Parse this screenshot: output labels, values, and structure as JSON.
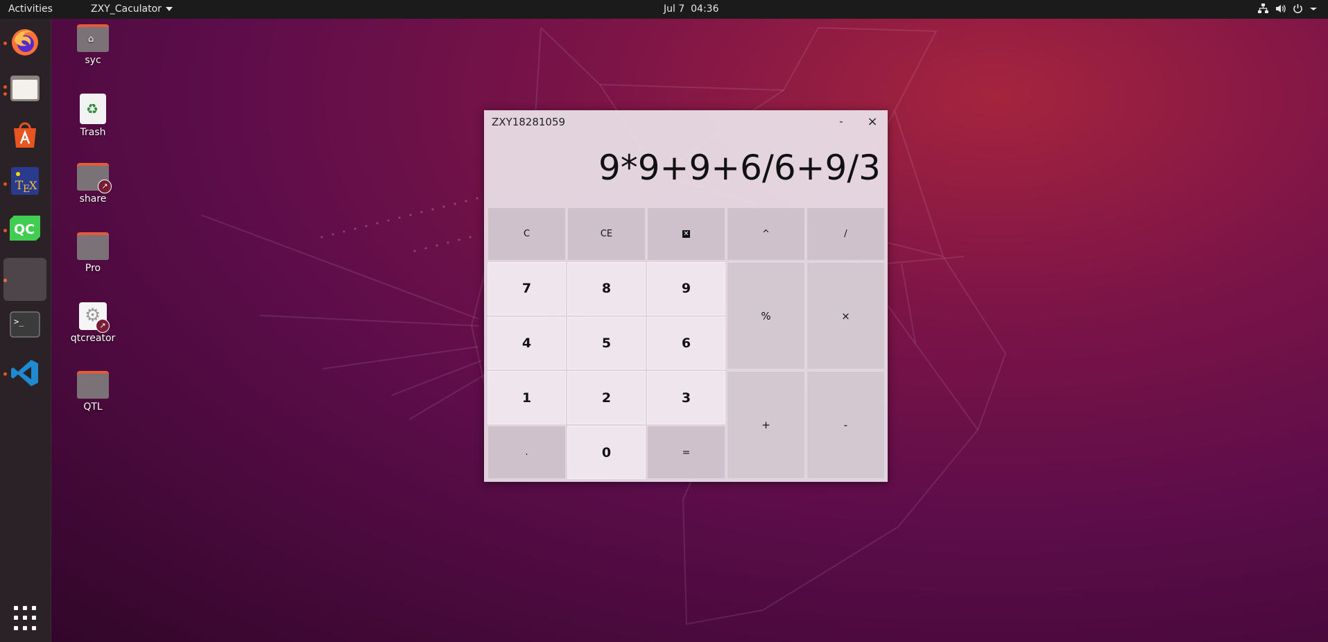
{
  "topbar": {
    "activities": "Activities",
    "app_name": "ZXY_Caculator",
    "clock": "Jul 7  04:36",
    "tray_icons": [
      "network-icon",
      "volume-icon",
      "power-icon",
      "chevron-down-icon"
    ]
  },
  "dock": {
    "items": [
      {
        "name": "firefox-icon",
        "running": true
      },
      {
        "name": "files-icon",
        "running": true
      },
      {
        "name": "software-store-icon",
        "running": false
      },
      {
        "name": "texstudio-icon",
        "running": true
      },
      {
        "name": "qtcreator-dock-icon",
        "running": true,
        "label": "QC"
      },
      {
        "name": "calculator-window-icon",
        "running": true,
        "active": true
      },
      {
        "name": "terminal-icon",
        "running": false,
        "label": ">_"
      },
      {
        "name": "vscode-icon",
        "running": true
      }
    ],
    "show_apps": "show-apps-icon"
  },
  "desktop": {
    "icons": [
      {
        "label": "syc",
        "type": "home-folder"
      },
      {
        "label": "Trash",
        "type": "trash"
      },
      {
        "label": "share",
        "type": "link-folder"
      },
      {
        "label": "Pro",
        "type": "folder"
      },
      {
        "label": "qtcreator",
        "type": "link-app"
      },
      {
        "label": "QTL",
        "type": "folder"
      }
    ]
  },
  "calculator": {
    "title": "ZXY18281059",
    "minimize_label": "-",
    "close_label": "×",
    "display": "9*9+9+6/6+9/3",
    "keys": {
      "clear": "C",
      "clear_entry": "CE",
      "backspace": "⌫",
      "power": "^",
      "divide": "/",
      "seven": "7",
      "eight": "8",
      "nine": "9",
      "percent": "%",
      "multiply": "×",
      "four": "4",
      "five": "5",
      "six": "6",
      "one": "1",
      "two": "2",
      "three": "3",
      "plus": "+",
      "minus": "-",
      "dot": ".",
      "zero": "0",
      "equals": "="
    }
  },
  "colors": {
    "topbar": "#1b1b1b",
    "dock": "#2b2228",
    "accent": "#e95420",
    "window_bg": "#ebe4ea"
  }
}
